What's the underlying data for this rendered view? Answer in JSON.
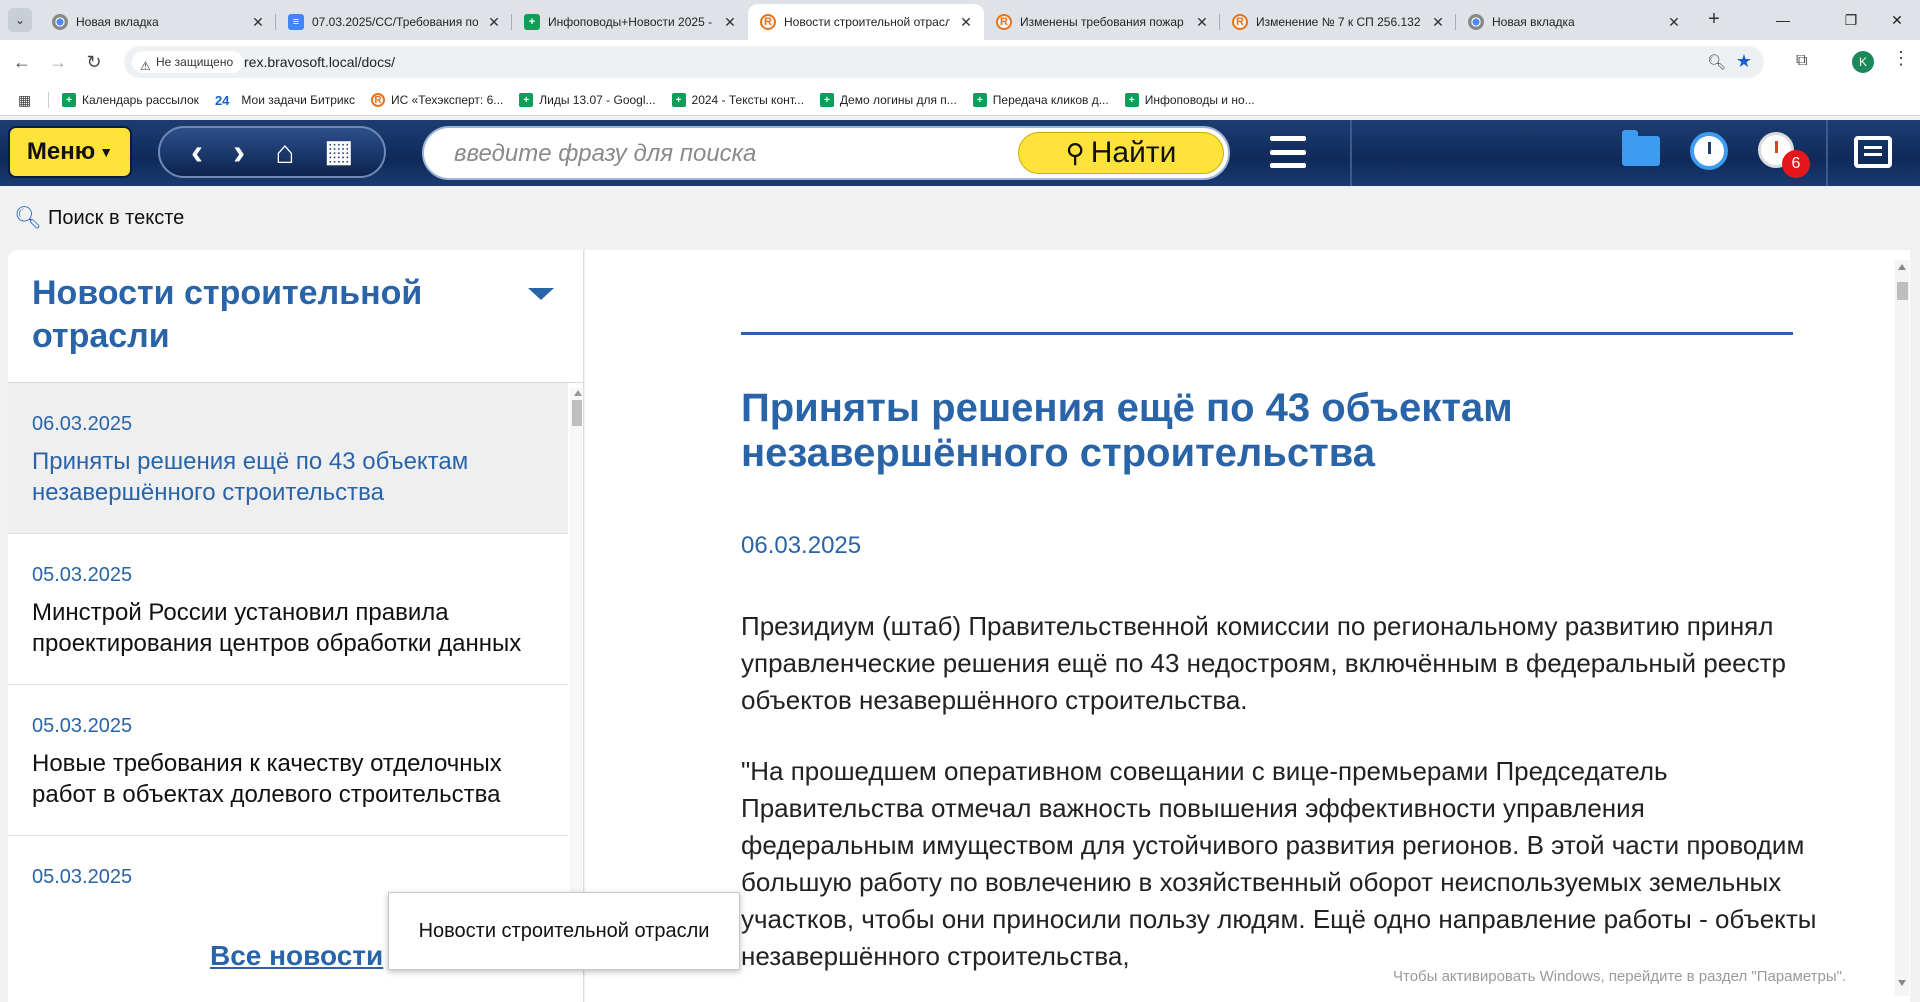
{
  "browser": {
    "tabs": [
      {
        "title": "Новая вкладка",
        "icon": "chrome-icon",
        "active": false
      },
      {
        "title": "07.03.2025/СС/Требования по",
        "icon": "docs-icon",
        "active": false
      },
      {
        "title": "Инфоповоды+Новости 2025 -",
        "icon": "sheets-icon",
        "active": false
      },
      {
        "title": "Новости строительной отрасл",
        "icon": "r-icon",
        "active": true
      },
      {
        "title": "Изменены требования пожар",
        "icon": "r-icon",
        "active": false
      },
      {
        "title": "Изменение № 7 к СП 256.132",
        "icon": "r-icon",
        "active": false
      },
      {
        "title": "Новая вкладка",
        "icon": "chrome-icon",
        "active": false
      }
    ],
    "security_label": "Не защищено",
    "url": "rex.bravosoft.local/docs/",
    "profile_initial": "K",
    "bookmarks": [
      {
        "label": "Календарь рассылок",
        "icon": "sheets-icon"
      },
      {
        "label": "Мои задачи Битрикс",
        "icon": "bitrix-icon",
        "prefix": "24"
      },
      {
        "label": "ИС «Техэксперт: 6...",
        "icon": "r-icon"
      },
      {
        "label": "Лиды 13.07 - Googl...",
        "icon": "sheets-icon"
      },
      {
        "label": "2024 - Тексты конт...",
        "icon": "sheets-icon"
      },
      {
        "label": "Демо логины для п...",
        "icon": "sheets-icon"
      },
      {
        "label": "Передача кликов д...",
        "icon": "sheets-icon"
      },
      {
        "label": "Инфоповоды и но...",
        "icon": "sheets-icon"
      }
    ]
  },
  "header": {
    "menu_label": "Меню",
    "search_placeholder": "введите фразу для поиска",
    "find_label": "Найти",
    "timer_badge": "6"
  },
  "subbar": {
    "find_in_text": "Поиск в тексте"
  },
  "left_panel": {
    "title": "Новости строительной отрасли",
    "items": [
      {
        "date": "06.03.2025",
        "title": "Приняты решения ещё по 43 объектам незавершённого строительства",
        "selected": true
      },
      {
        "date": "05.03.2025",
        "title": "Минстрой России установил правила проектирования центров обработки данных",
        "selected": false
      },
      {
        "date": "05.03.2025",
        "title": "Новые требования к качеству отделочных работ в объектах долевого строительства",
        "selected": false
      },
      {
        "date": "05.03.2025",
        "title": "",
        "selected": false
      }
    ],
    "all_news": "Все новости"
  },
  "article": {
    "title": "Приняты решения ещё по 43 объектам незавершённого строительства",
    "date": "06.03.2025",
    "paragraphs": [
      "Президиум (штаб) Правительственной комиссии по региональному развитию принял управленческие решения ещё по 43 недостроям, включённым в федеральный реестр объектов незавершённого строительства.",
      "\"На прошедшем оперативном совещании с вице-премьерами Председатель Правительства отмечал важность повышения эффективности управления федеральным имуществом для устойчивого развития регионов. В этой части проводим большую работу по вовлечению в хозяйственный оборот неиспользуемых земельных участков, чтобы они приносили пользу людям. Ещё одно направление работы - объекты незавершённого строительства,"
    ]
  },
  "tooltip": "Новости строительной отрасли",
  "os_watermark": "Чтобы активировать Windows, перейдите в раздел \"Параметры\"."
}
